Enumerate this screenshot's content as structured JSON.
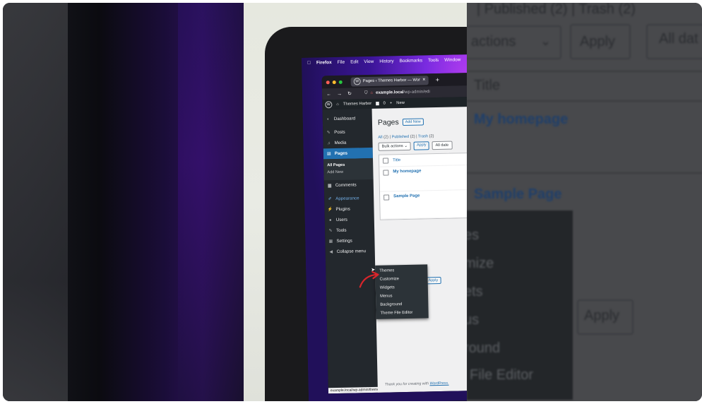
{
  "macos_menu": {
    "apple": "",
    "items": [
      "Firefox",
      "File",
      "Edit",
      "View",
      "History",
      "Bookmarks",
      "Tools",
      "Window"
    ]
  },
  "browser": {
    "tab_title": "Pages ‹ Themes Harbor — Wor",
    "new_tab": "+",
    "url_host": "example.local",
    "url_path": "/wp-admin/edi"
  },
  "wp_admin_bar": {
    "site_name": "Themes Harbor",
    "comments_count": "0",
    "new_label": "New"
  },
  "sidebar": {
    "items": [
      {
        "label": "Dashboard",
        "icon": "dashboard-icon"
      },
      {
        "label": "Posts",
        "icon": "pin-icon"
      },
      {
        "label": "Media",
        "icon": "media-icon"
      },
      {
        "label": "Pages",
        "icon": "page-icon"
      },
      {
        "label": "Comments",
        "icon": "comment-icon"
      },
      {
        "label": "Appearance",
        "icon": "brush-icon"
      },
      {
        "label": "Plugins",
        "icon": "plugin-icon"
      },
      {
        "label": "Users",
        "icon": "user-icon"
      },
      {
        "label": "Tools",
        "icon": "wrench-icon"
      },
      {
        "label": "Settings",
        "icon": "settings-icon"
      },
      {
        "label": "Collapse menu",
        "icon": "collapse-icon"
      }
    ],
    "pages_submenu": [
      "All Pages",
      "Add New"
    ]
  },
  "appearance_flyout": [
    "Themes",
    "Customize",
    "Widgets",
    "Menus",
    "Background",
    "Theme File Editor"
  ],
  "pages_screen": {
    "title": "Pages",
    "add_new": "Add New",
    "filter_all": "All",
    "filter_all_count": "(2)",
    "filter_published": "Published",
    "filter_published_count": "(2)",
    "filter_trash": "Trash",
    "filter_trash_count": "(2)",
    "bulk_actions": "Bulk actions",
    "apply": "Apply",
    "all_dates": "All date",
    "col_title": "Title",
    "rows": [
      "My homepage",
      "Sample Page"
    ],
    "footer_text": "Thank you for creating with",
    "footer_link": "WordPress."
  },
  "status_url": "example.local/wp-admin/themes.php",
  "zoom_panel": {
    "published_trash": "| Published (2) | Trash (2)",
    "actions": "actions",
    "apply": "Apply",
    "all_date": "All dat",
    "title": "Title",
    "row1": "My homepage",
    "row2": "Sample Page",
    "flyout_fragments": [
      "es",
      "mize",
      "ets",
      "us",
      "round",
      "File Editor"
    ],
    "apply_bottom": "Apply"
  },
  "colors": {
    "wp_blue": "#2271b1",
    "wp_admin_dark": "#23282d",
    "wallpaper_purple": "#3a1496"
  }
}
